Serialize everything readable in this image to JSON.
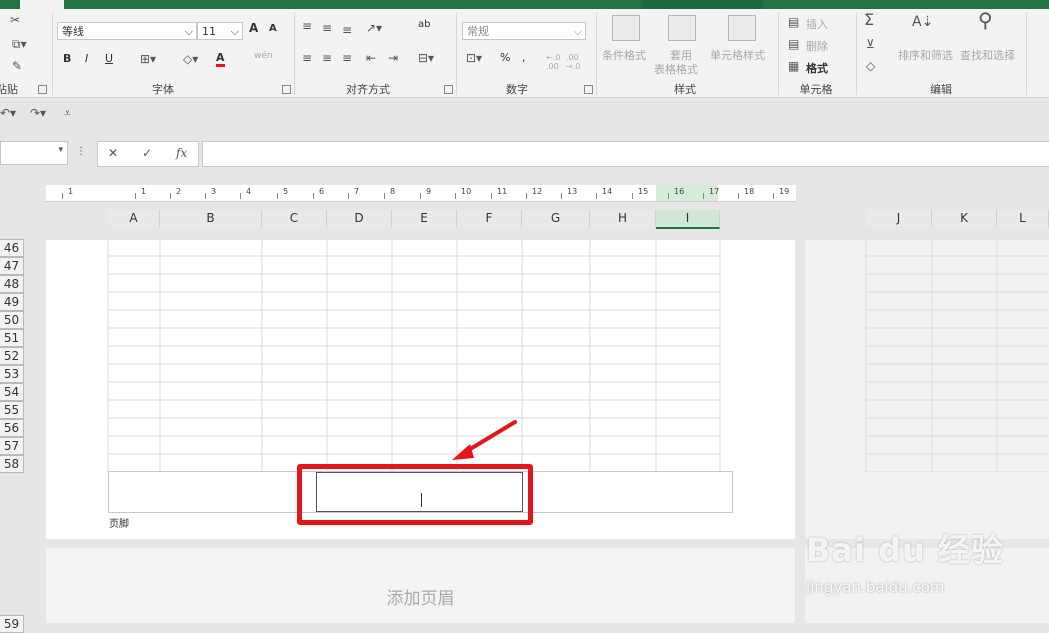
{
  "ribbon": {
    "font_group_label": "字体",
    "align_group_label": "对齐方式",
    "number_group_label": "数字",
    "styles_group_label": "样式",
    "cells_group_label": "单元格",
    "edit_group_label": "编辑",
    "clipboard_group_label": "粘贴板",
    "font_name": "等线",
    "font_size": "11",
    "bold": "B",
    "italic": "I",
    "underline": "U",
    "number_format": "常规",
    "percent": "%",
    "comma": ",",
    "increase_decimal": "←.0 .00",
    "decrease_decimal": ".00 →.0",
    "conditional_format": "条件格式",
    "table_format_1": "套用",
    "table_format_2": "表格格式",
    "cell_styles": "单元格样式",
    "insert": "插入",
    "delete": "删除",
    "format": "格式",
    "sort_filter": "排序和筛选",
    "find_select": "查找和选择",
    "wrap_text": "ab",
    "font_grow": "A",
    "font_shrink": "A",
    "wen": "wén"
  },
  "formula_bar": {
    "fx": "fx",
    "cancel": "✕",
    "enter": "✓",
    "value": ""
  },
  "ruler": [
    "1",
    "1",
    "2",
    "3",
    "4",
    "5",
    "6",
    "7",
    "8",
    "9",
    "10",
    "11",
    "12",
    "13",
    "14",
    "15",
    "16",
    "17",
    "18",
    "19"
  ],
  "columns": [
    "A",
    "B",
    "C",
    "D",
    "E",
    "F",
    "G",
    "H",
    "I"
  ],
  "right_columns": [
    "J",
    "K",
    "L"
  ],
  "rows": [
    "46",
    "47",
    "48",
    "49",
    "50",
    "51",
    "52",
    "53",
    "54",
    "55",
    "56",
    "57",
    "58"
  ],
  "footer_label": "页脚",
  "add_header": "添加页眉",
  "next_row": "59",
  "watermark": {
    "brand": "Bai du 经验",
    "url": "jingyan.baidu.com"
  },
  "colors": {
    "excel_green": "#217346",
    "highlight_red": "#e3161b"
  }
}
